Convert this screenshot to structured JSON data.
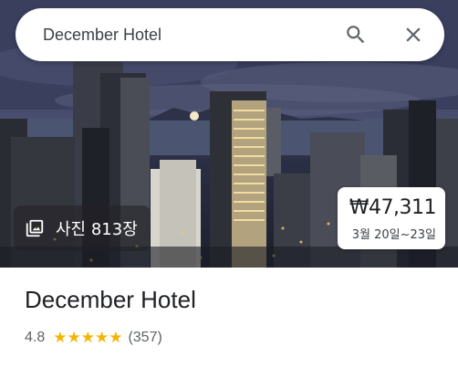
{
  "search": {
    "query": "December Hotel",
    "search_icon": "search-icon",
    "close_icon": "close-icon"
  },
  "hero": {
    "photos_icon": "photo-library-icon",
    "photos_label": "사진 813장"
  },
  "price": {
    "amount": "₩47,311",
    "dates": "3월 20일~23일"
  },
  "hotel": {
    "name": "December Hotel",
    "rating": "4.8",
    "stars": "★★★★★",
    "review_count": "(357)",
    "star_color": "#f5b400"
  }
}
